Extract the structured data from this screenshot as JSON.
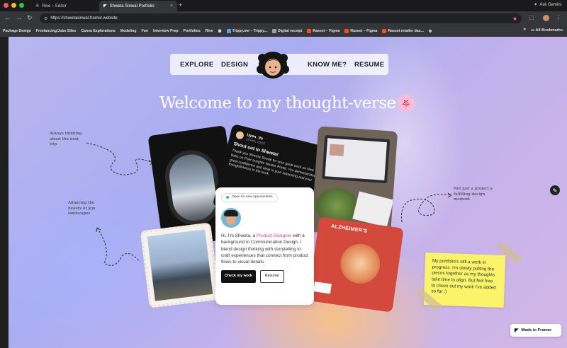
{
  "browser": {
    "tabs": [
      {
        "label": "Rive – Editor"
      },
      {
        "label": "Shweta Sinwal Portfolio"
      }
    ],
    "new_tab": "+",
    "ask_gemini": "Ask Gemini",
    "url": "https://shwetasinwal.framer.website",
    "bookmarks": [
      "Package Design",
      "Freelancing/Jobs Sites",
      "Canva Explorations",
      "Modeling",
      "Fun",
      "Interview Prep",
      "Portfolios",
      "Rive",
      "Trippy.me – Trippy...",
      "Digital receipt",
      "Raseet – Figma",
      "Raseet – Figma",
      "Raseet retailer das..."
    ],
    "all_bookmarks": "All Bookmarks",
    "overflow": "»"
  },
  "nav": {
    "explore": "EXPLORE",
    "design": "DESIGN",
    "know_me": "KNOW ME?",
    "resume": "RESUME"
  },
  "hero": {
    "title": "Welcome to my thought-verse🌸"
  },
  "notes": {
    "thinking": "Always thinking about the next trip",
    "admiring": "Admiring the beauty of jeju landscapes",
    "not_project": "Not just a project a fulfilling design moment"
  },
  "tweet": {
    "user": "Uyen_Vo",
    "date": "13 Feb, 23:02",
    "heading": "Shout out to Shweta!",
    "body": "Thank you Shweta Sinwal for your great work on New Relic on Peer Insights Vendor Portal. You demonstrated great confidence and clear in your reasoning and your thoughtfulness in the work."
  },
  "intro": {
    "badge": "Open for new opportunities",
    "text_pre": "Hi, I'm Shweta, a ",
    "text_role": "Product Designer",
    "text_post": " with a background in Communication Design. I blend design thinking with storytelling to craft experiences that connect from product flows to visual details.",
    "cta_primary": "Check my work",
    "cta_secondary": "Resume"
  },
  "book": {
    "title": "ALZHEIMER'S"
  },
  "sticky": {
    "text": "My portfolio's still a work in progress. I'm slowly putting the pieces together as my thoughts take time to align. But feel free to check out my work I've added so far :)"
  },
  "badge": {
    "made_in_framer": "Made in Framer"
  },
  "colors": {
    "accent_pink": "#e0457b",
    "sticky_yellow": "#fbf36a",
    "status_green": "#35c95a"
  }
}
